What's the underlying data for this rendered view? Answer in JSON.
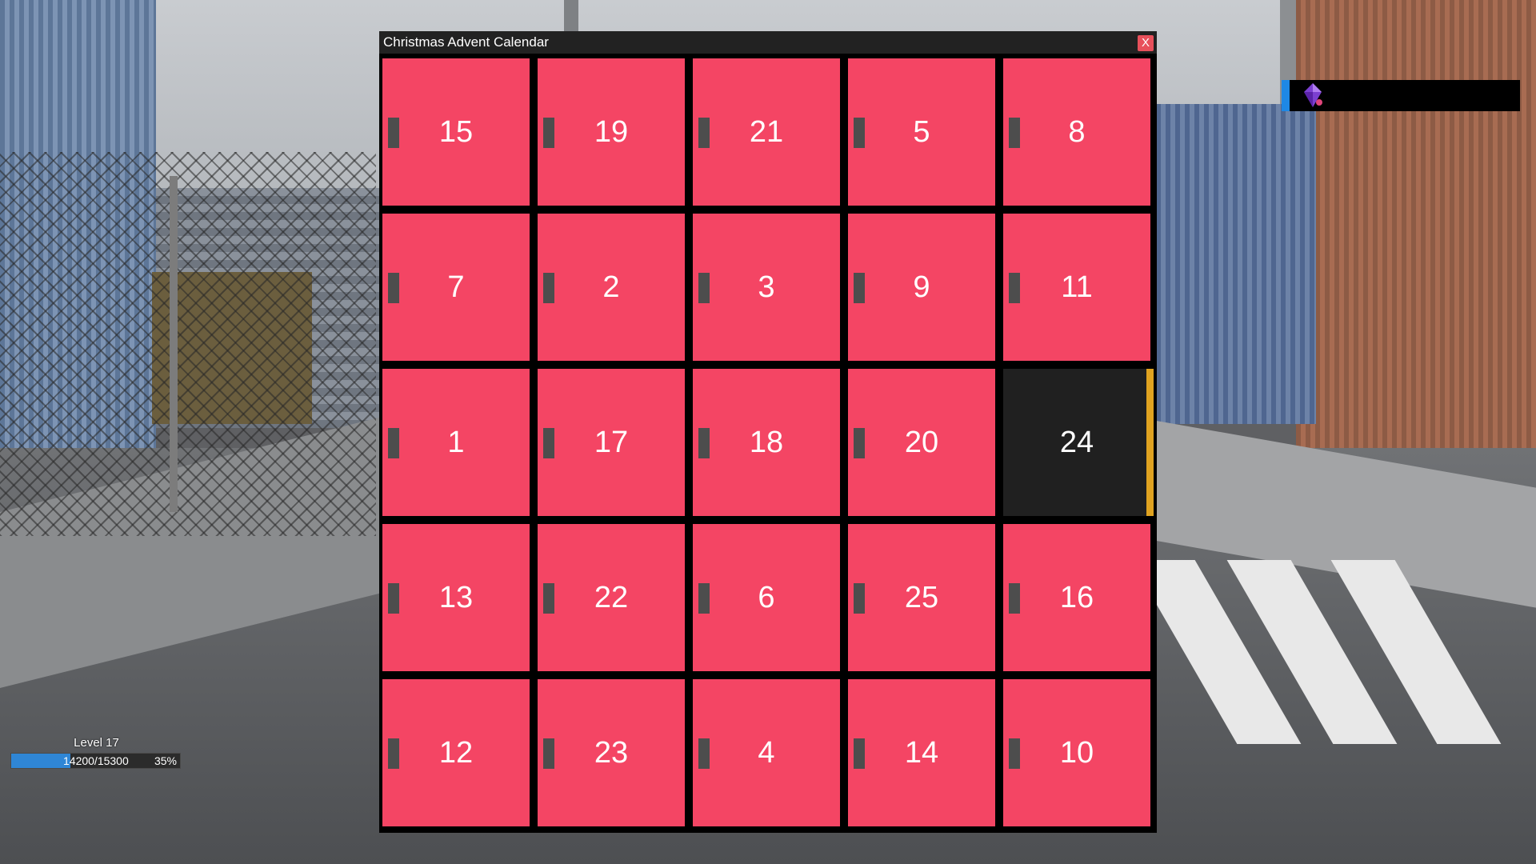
{
  "window": {
    "title": "Christmas Advent Calendar",
    "close_label": "X"
  },
  "doors": [
    {
      "day": "15",
      "opened": false
    },
    {
      "day": "19",
      "opened": false
    },
    {
      "day": "21",
      "opened": false
    },
    {
      "day": "5",
      "opened": false
    },
    {
      "day": "8",
      "opened": false
    },
    {
      "day": "7",
      "opened": false
    },
    {
      "day": "2",
      "opened": false
    },
    {
      "day": "3",
      "opened": false
    },
    {
      "day": "9",
      "opened": false
    },
    {
      "day": "11",
      "opened": false
    },
    {
      "day": "1",
      "opened": false
    },
    {
      "day": "17",
      "opened": false
    },
    {
      "day": "18",
      "opened": false
    },
    {
      "day": "20",
      "opened": false
    },
    {
      "day": "24",
      "opened": true
    },
    {
      "day": "13",
      "opened": false
    },
    {
      "day": "22",
      "opened": false
    },
    {
      "day": "6",
      "opened": false
    },
    {
      "day": "25",
      "opened": false
    },
    {
      "day": "16",
      "opened": false
    },
    {
      "day": "12",
      "opened": false
    },
    {
      "day": "23",
      "opened": false
    },
    {
      "day": "4",
      "opened": false
    },
    {
      "day": "14",
      "opened": false
    },
    {
      "day": "10",
      "opened": false
    }
  ],
  "colors": {
    "door": "#f44564",
    "door_opened": "#202020",
    "accent": "#e0a320",
    "xp_fill": "#2f86d6"
  },
  "hud": {
    "level_label": "Level 17",
    "xp_text": "14200/15300",
    "xp_percent_label": "35%",
    "xp_fill_fraction": 0.35
  },
  "notification": {
    "icon": "purple-gem-icon"
  }
}
